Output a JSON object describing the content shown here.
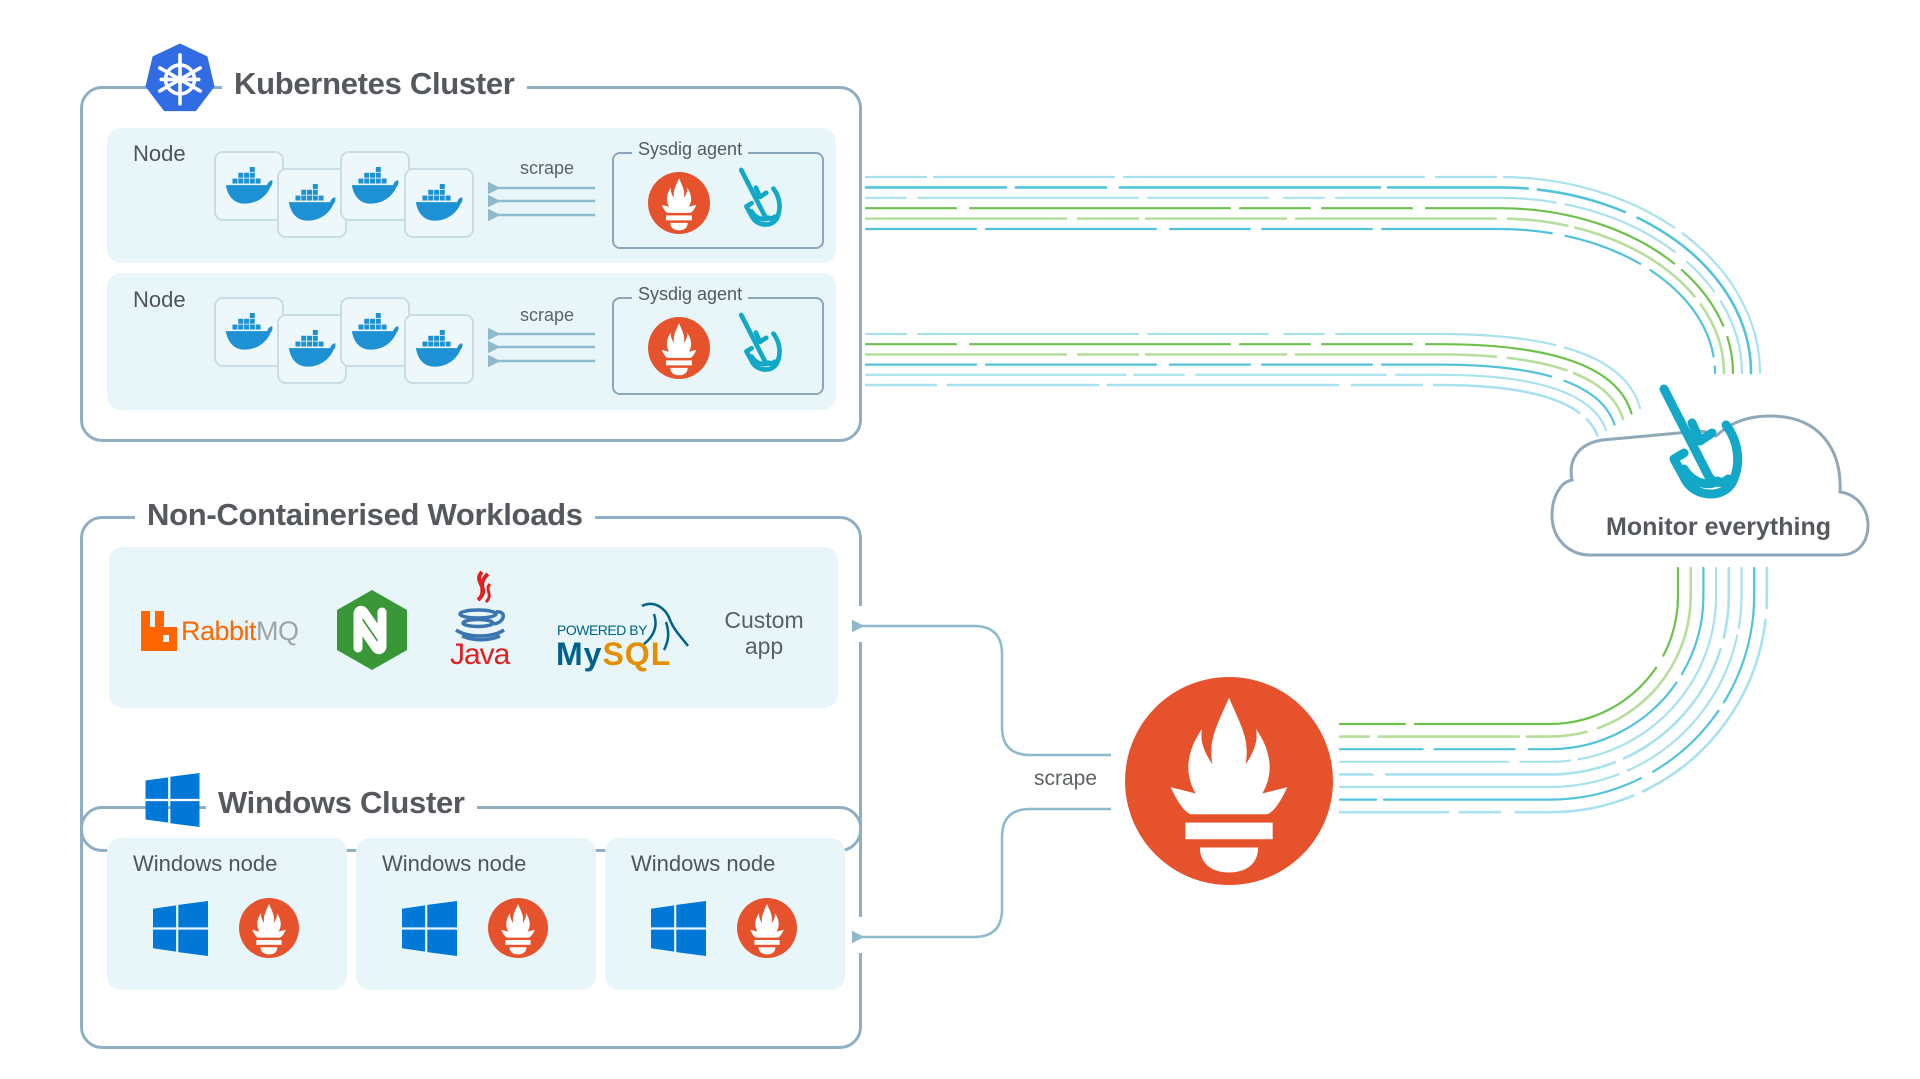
{
  "kubernetes_cluster": {
    "title": "Kubernetes Cluster",
    "icon": "kubernetes-helm-icon",
    "nodes": [
      {
        "label": "Node",
        "containers": 4,
        "container_icon": "docker-whale-icon",
        "scrape_label": "scrape",
        "agent": {
          "title": "Sysdig agent",
          "icons": [
            "prometheus-icon",
            "sysdig-shovel-icon"
          ]
        }
      },
      {
        "label": "Node",
        "containers": 4,
        "container_icon": "docker-whale-icon",
        "scrape_label": "scrape",
        "agent": {
          "title": "Sysdig agent",
          "icons": [
            "prometheus-icon",
            "sysdig-shovel-icon"
          ]
        }
      }
    ]
  },
  "non_containerised": {
    "title": "Non-Containerised Workloads",
    "workloads": [
      {
        "name": "RabbitMQ",
        "part1": "Rabbit",
        "part2": "MQ",
        "icon": "rabbitmq-logo"
      },
      {
        "name": "NGINX",
        "letter": "N",
        "icon": "nginx-logo"
      },
      {
        "name": "Java",
        "text": "Java",
        "icon": "java-logo"
      },
      {
        "name": "MySQL",
        "powered_by": "POWERED BY",
        "text_my": "My",
        "text_sql": "SQL",
        "icon": "mysql-logo"
      },
      {
        "name": "Custom app",
        "line1": "Custom",
        "line2": "app"
      }
    ]
  },
  "windows_cluster": {
    "title": "Windows Cluster",
    "icon": "windows-logo-icon",
    "nodes": [
      {
        "label": "Windows node",
        "icons": [
          "windows-logo-icon",
          "prometheus-icon"
        ]
      },
      {
        "label": "Windows node",
        "icons": [
          "windows-logo-icon",
          "prometheus-icon"
        ]
      },
      {
        "label": "Windows node",
        "icons": [
          "windows-logo-icon",
          "prometheus-icon"
        ]
      }
    ]
  },
  "prometheus_server": {
    "icon": "prometheus-icon",
    "scrape_label": "scrape"
  },
  "cloud": {
    "label": "Monitor everything",
    "icon": "sysdig-shovel-icon"
  },
  "colors": {
    "prometheus": "#e6522c",
    "kubernetes": "#326ce5",
    "docker": "#1d91d4",
    "windows": "#0078d7",
    "sysdig": "#13a8c8",
    "border": "#8fb0c4",
    "panel": "#e8f6fa",
    "flow_light_cyan": "#a8e2ef",
    "flow_cyan": "#52c3dc",
    "flow_green": "#6cc24a",
    "flow_light_green": "#b6df9b",
    "nginx": "#3a9737",
    "rabbitmq": "#ff6600",
    "java_red": "#e11f21",
    "java_blue": "#3a75b0",
    "mysql_blue": "#00618a",
    "mysql_orange": "#e48e00"
  }
}
